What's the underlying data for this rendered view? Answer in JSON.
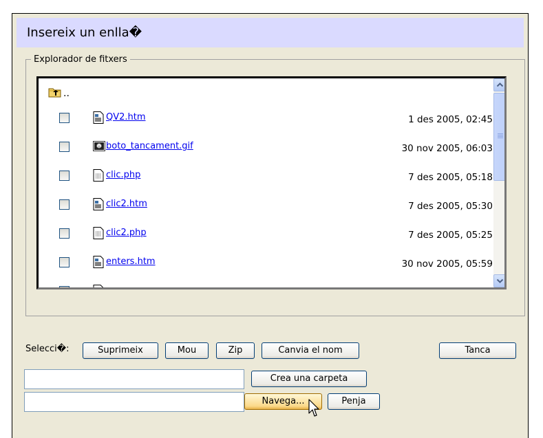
{
  "dialog": {
    "title": "Insereix un enlla�"
  },
  "browser": {
    "legend": "Explorador de fitxers",
    "parent_label": "..",
    "files": [
      {
        "name": "QV2.htm",
        "date": "1 des 2005, 02:45",
        "icon": "html-file-icon"
      },
      {
        "name": "boto_tancament.gif",
        "date": "30 nov 2005, 06:03",
        "icon": "image-file-icon"
      },
      {
        "name": "clic.php",
        "date": "7 des 2005, 05:18",
        "icon": "php-file-icon"
      },
      {
        "name": "clic2.htm",
        "date": "7 des 2005, 05:30",
        "icon": "html-file-icon"
      },
      {
        "name": "clic2.php",
        "date": "7 des 2005, 05:25",
        "icon": "php-file-icon"
      },
      {
        "name": "enters.htm",
        "date": "30 nov 2005, 05:59",
        "icon": "html-file-icon"
      }
    ]
  },
  "actions": {
    "selection_label": "Selecci�:",
    "delete": "Suprimeix",
    "move": "Mou",
    "zip": "Zip",
    "rename": "Canvia el nom",
    "close": "Tanca",
    "create_folder": "Crea una carpeta",
    "browse": "Navega...",
    "upload": "Penja"
  },
  "inputs": {
    "folder_name_value": "",
    "upload_file_value": ""
  },
  "colors": {
    "title_bg": "#dadaff",
    "panel_bg": "#ece9d8",
    "link": "#0000ee"
  }
}
